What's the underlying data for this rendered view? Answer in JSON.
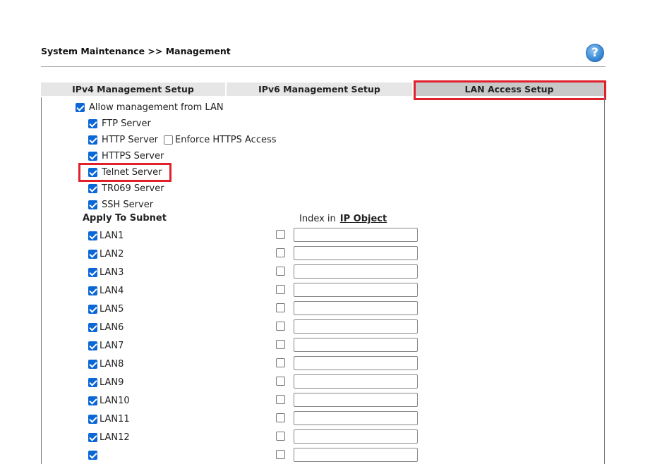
{
  "header": {
    "title": "System Maintenance >> Management",
    "help_label": "?"
  },
  "tabs": [
    {
      "label": "IPv4 Management Setup"
    },
    {
      "label": "IPv6 Management Setup"
    },
    {
      "label": "LAN Access Setup"
    }
  ],
  "form": {
    "allow_label": "Allow management from LAN",
    "ftp": "FTP Server",
    "http": "HTTP Server",
    "enforce_https": "Enforce HTTPS Access",
    "https": "HTTPS Server",
    "telnet": "Telnet Server",
    "tr069": "TR069 Server",
    "ssh": "SSH Server",
    "apply_subnet": "Apply To Subnet",
    "index_in": "Index in",
    "ip_object": "IP Object"
  },
  "subnets": [
    {
      "label": "LAN1"
    },
    {
      "label": "LAN2"
    },
    {
      "label": "LAN3"
    },
    {
      "label": "LAN4"
    },
    {
      "label": "LAN5"
    },
    {
      "label": "LAN6"
    },
    {
      "label": "LAN7"
    },
    {
      "label": "LAN8"
    },
    {
      "label": "LAN9"
    },
    {
      "label": "LAN10"
    },
    {
      "label": "LAN11"
    },
    {
      "label": "LAN12"
    },
    {
      "label": ""
    }
  ],
  "colors": {
    "checkbox": "#0b66d6",
    "highlight": "#e0202a",
    "active_tab": "#c8c8c8",
    "tab": "#e6e6e6"
  }
}
